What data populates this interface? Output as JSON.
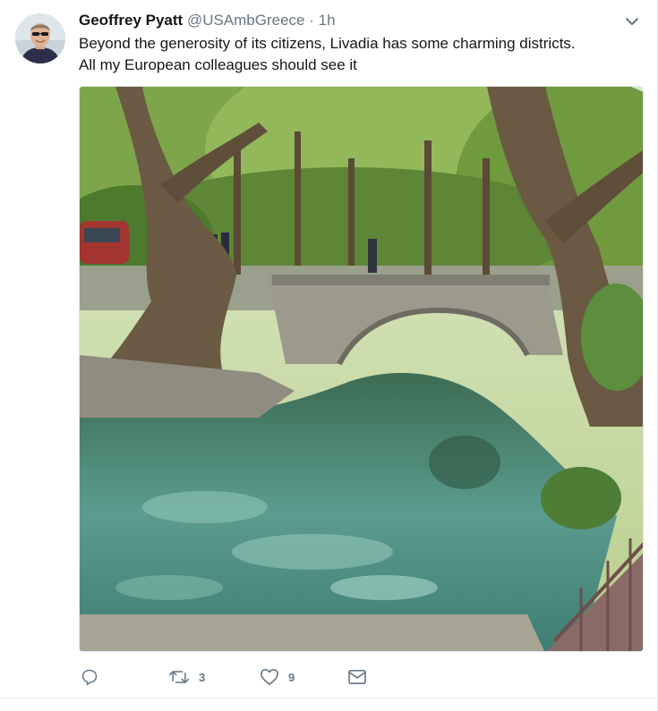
{
  "tweet": {
    "author": {
      "name": "Geoffrey Pyatt",
      "handle": "@USAmbGreece",
      "separator": "·",
      "time": "1h",
      "avatar_icon": "avatar-photo"
    },
    "text_lines": [
      "Beyond the generosity of its citizens, Livadia has some charming districts.",
      "All my European colleagues should see it"
    ],
    "photo": {
      "icon": "photo-stone-bridge-over-stream"
    },
    "actions": {
      "reply": {
        "icon": "reply-icon",
        "count": ""
      },
      "retweet": {
        "icon": "retweet-icon",
        "count": "3"
      },
      "like": {
        "icon": "heart-icon",
        "count": "9"
      },
      "message": {
        "icon": "envelope-icon",
        "count": ""
      }
    },
    "menu_icon": "chevron-down-icon"
  },
  "colors": {
    "text": "#14171a",
    "secondary": "#657786",
    "border": "#e1e8ed"
  }
}
